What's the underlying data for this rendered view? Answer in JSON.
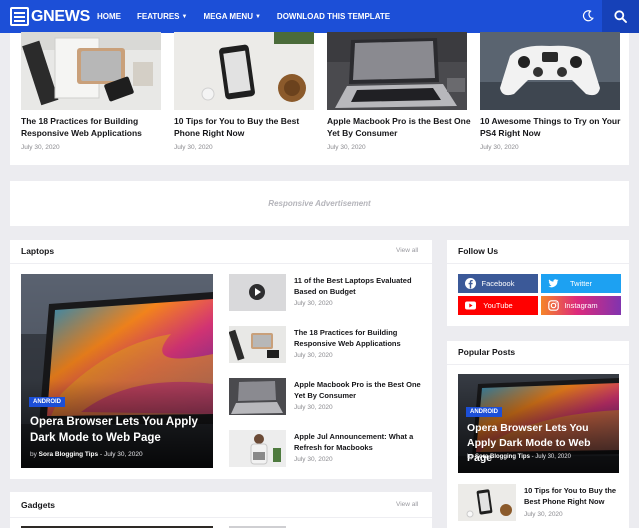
{
  "nav": {
    "logo_text": "GNEWS",
    "items": [
      {
        "label": "HOME",
        "has_dropdown": false
      },
      {
        "label": "FEATURES",
        "has_dropdown": true
      },
      {
        "label": "MEGA MENU",
        "has_dropdown": true
      },
      {
        "label": "DOWNLOAD THIS TEMPLATE",
        "has_dropdown": false
      }
    ],
    "icons": [
      "moon-icon",
      "search-icon"
    ],
    "colors": {
      "bar": "#1c4fd7",
      "search_bg": "#1641b8"
    }
  },
  "top_posts": [
    {
      "title": "The 18 Practices for Building Responsive Web Applications",
      "date": "July 30, 2020"
    },
    {
      "title": "10 Tips for You to Buy the Best Phone Right Now",
      "date": "July 30, 2020"
    },
    {
      "title": "Apple Macbook Pro is the Best One Yet By Consumer",
      "date": "July 30, 2020"
    },
    {
      "title": "10 Awesome Things to Try on Your PS4 Right Now",
      "date": "July 30, 2020"
    }
  ],
  "advertisement": {
    "label": "Responsive Advertisement"
  },
  "laptops": {
    "title": "Laptops",
    "view_all": "View all",
    "featured": {
      "tag": "ANDROID",
      "title": "Opera Browser Lets You Apply Dark Mode to Web Page",
      "author": "Sora Blogging Tips",
      "separator": "-",
      "date": "July 30, 2020"
    },
    "items": [
      {
        "title": "11 of the Best Laptops Evaluated Based on Budget",
        "date": "July 30, 2020"
      },
      {
        "title": "The 18 Practices for Building Responsive Web Applications",
        "date": "July 30, 2020"
      },
      {
        "title": "Apple Macbook Pro is the Best One Yet By Consumer",
        "date": "July 30, 2020"
      },
      {
        "title": "Apple Jul Announcement: What a Refresh for Macbooks",
        "date": "July 30, 2020"
      }
    ]
  },
  "gadgets": {
    "title": "Gadgets",
    "view_all": "View all"
  },
  "follow_us": {
    "title": "Follow Us",
    "networks": [
      {
        "label": "Facebook",
        "icon": "facebook-icon",
        "color": "#3b5998"
      },
      {
        "label": "Twitter",
        "icon": "twitter-icon",
        "color": "#1da1f2"
      },
      {
        "label": "YouTube",
        "icon": "youtube-icon",
        "color": "#ff0000"
      },
      {
        "label": "Instagram",
        "icon": "instagram-icon",
        "color": "#d6249f"
      }
    ]
  },
  "popular_posts": {
    "title": "Popular Posts",
    "featured": {
      "tag": "ANDROID",
      "title": "Opera Browser Lets You Apply Dark Mode to Web Page",
      "author": "Sora Blogging Tips",
      "separator": "-",
      "date": "July 30, 2020"
    },
    "items": [
      {
        "title": "10 Tips for You to Buy the Best Phone Right Now",
        "date": "July 30, 2020"
      }
    ]
  }
}
